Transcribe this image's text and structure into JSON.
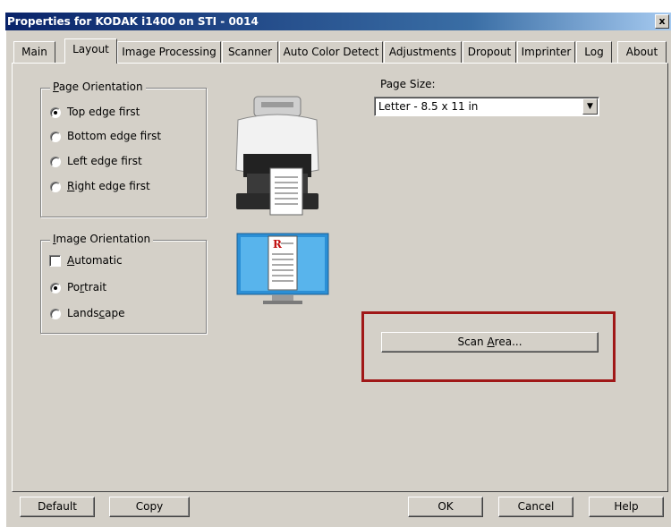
{
  "window": {
    "title": "Properties for KODAK i1400 on STI - 0014",
    "close_label": "x"
  },
  "tabs": [
    {
      "label": "Main"
    },
    {
      "label": "Layout"
    },
    {
      "label": "Image Processing"
    },
    {
      "label": "Scanner"
    },
    {
      "label": "Auto Color Detect"
    },
    {
      "label": "Adjustments"
    },
    {
      "label": "Dropout"
    },
    {
      "label": "Imprinter"
    },
    {
      "label": "Log"
    },
    {
      "label": "About"
    }
  ],
  "active_tab": "Layout",
  "page_orientation": {
    "title_prefix": "",
    "title_mnemonic": "P",
    "title_rest": "age Orientation",
    "options": [
      {
        "label": "Top edge first",
        "selected": true
      },
      {
        "label": "Bottom edge first",
        "selected": false
      },
      {
        "label": "Left edge first",
        "selected": false
      },
      {
        "pre": "",
        "mn": "R",
        "post": "ight edge first",
        "selected": false
      }
    ]
  },
  "image_orientation": {
    "title_mnemonic": "I",
    "title_rest": "mage Orientation",
    "automatic": {
      "pre": "",
      "mn": "A",
      "post": "utomatic",
      "checked": false
    },
    "portrait": {
      "pre": "Po",
      "mn": "r",
      "post": "trait",
      "selected": true
    },
    "landscape": {
      "pre": "Lands",
      "mn": "c",
      "post": "ape",
      "selected": false
    }
  },
  "page_size": {
    "label": "Page Size:",
    "value": "Letter - 8.5 x 11 in",
    "dropdown_glyph": "▼"
  },
  "scan_area_button": {
    "pre": "Scan ",
    "mn": "A",
    "post": "rea..."
  },
  "icons": {
    "scanner": "scanner-icon",
    "monitor": "monitor-document-icon",
    "doc_letter": "R"
  },
  "footer": {
    "default_label": "Default",
    "copy_label": "Copy",
    "ok_label": "OK",
    "cancel_label": "Cancel",
    "help_label": "Help"
  },
  "colors": {
    "highlight_box": "#a01818",
    "title_bar": "#0a246a",
    "dialog_bg": "#d4d0c8"
  }
}
